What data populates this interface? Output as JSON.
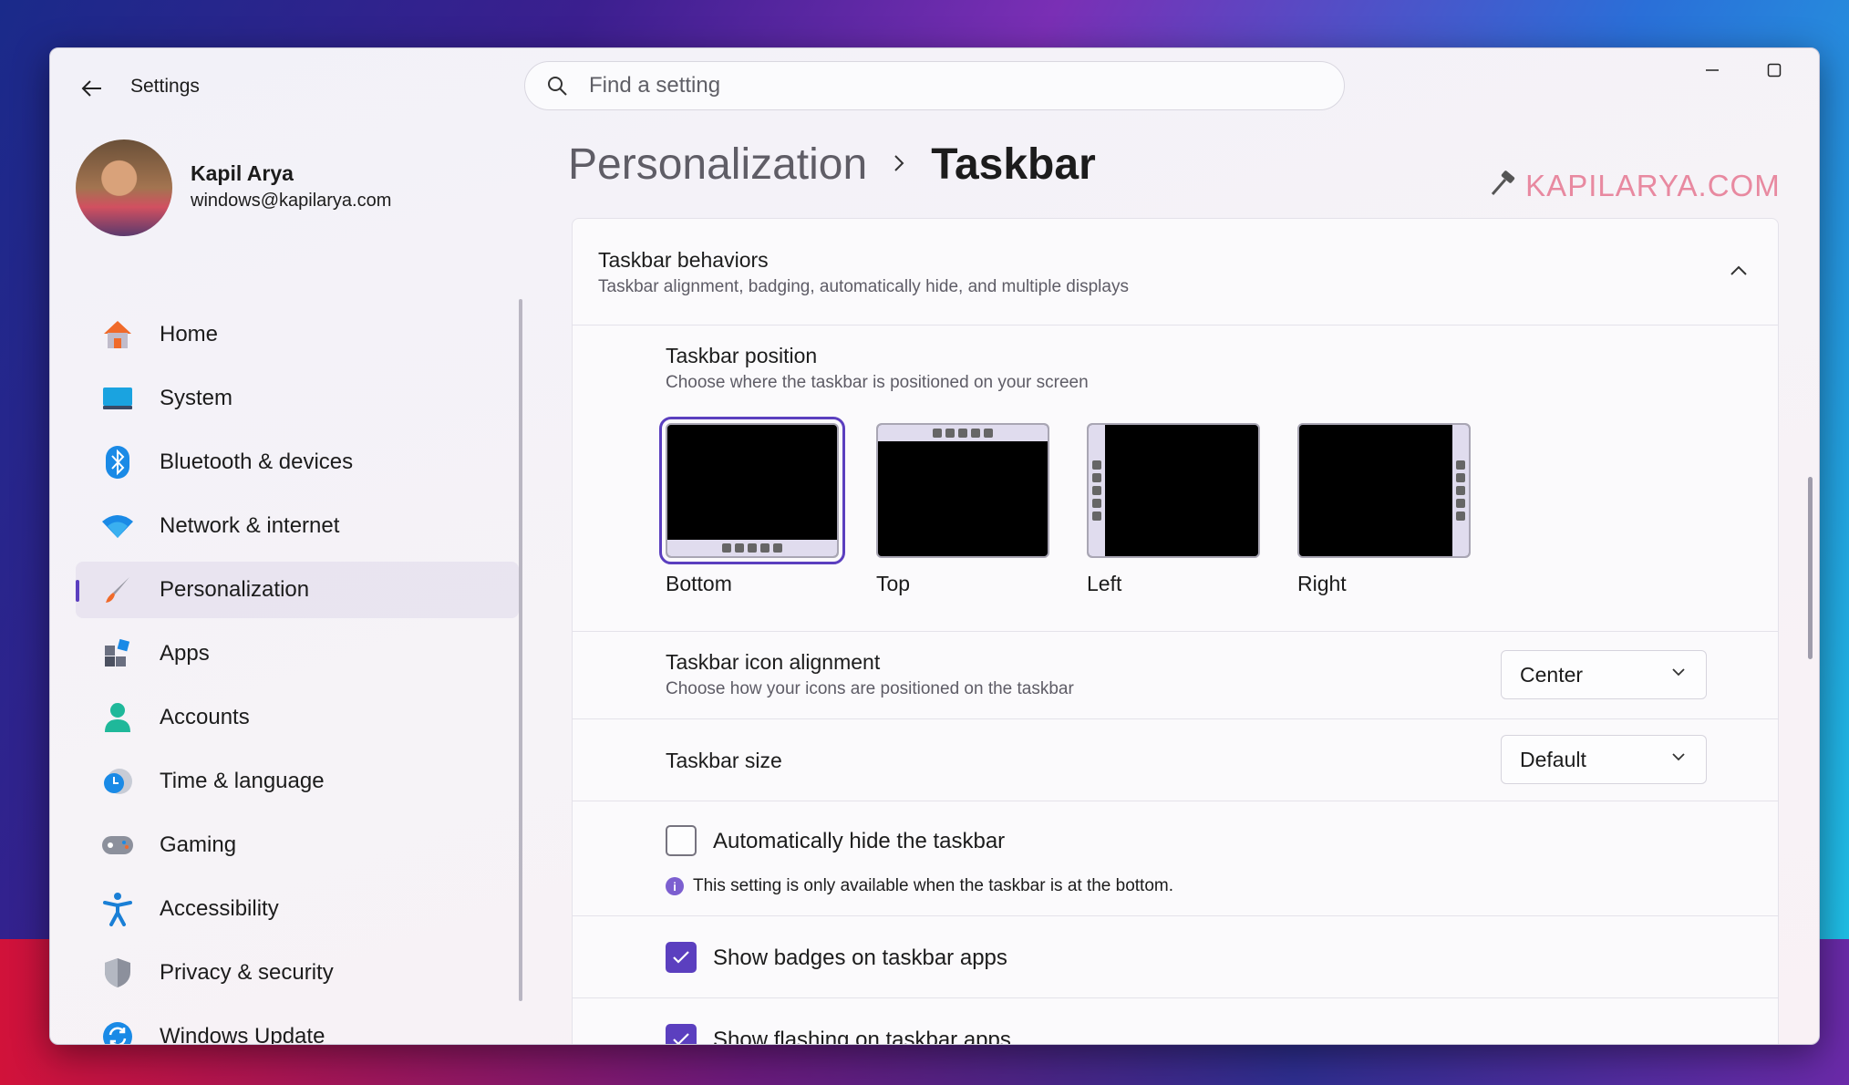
{
  "window": {
    "title": "Settings",
    "controls": {
      "minimize": "—",
      "maximize": "☐",
      "close": "✕"
    }
  },
  "search": {
    "placeholder": "Find a setting",
    "value": ""
  },
  "profile": {
    "name": "Kapil Arya",
    "email": "windows@kapilarya.com"
  },
  "nav": {
    "items": [
      {
        "label": "Home",
        "icon": "home-icon"
      },
      {
        "label": "System",
        "icon": "system-icon"
      },
      {
        "label": "Bluetooth & devices",
        "icon": "bluetooth-icon"
      },
      {
        "label": "Network & internet",
        "icon": "wifi-icon"
      },
      {
        "label": "Personalization",
        "icon": "brush-icon",
        "active": true
      },
      {
        "label": "Apps",
        "icon": "apps-icon"
      },
      {
        "label": "Accounts",
        "icon": "accounts-icon"
      },
      {
        "label": "Time & language",
        "icon": "time-language-icon"
      },
      {
        "label": "Gaming",
        "icon": "gaming-icon"
      },
      {
        "label": "Accessibility",
        "icon": "accessibility-icon"
      },
      {
        "label": "Privacy & security",
        "icon": "shield-icon"
      },
      {
        "label": "Windows Update",
        "icon": "windows-update-icon"
      }
    ]
  },
  "breadcrumb": {
    "parent": "Personalization",
    "current": "Taskbar"
  },
  "watermark": "KAPILARYA.COM",
  "behaviors": {
    "title": "Taskbar behaviors",
    "subtitle": "Taskbar alignment, badging, automatically hide, and multiple displays",
    "position": {
      "title": "Taskbar position",
      "subtitle": "Choose where the taskbar is positioned on your screen",
      "options": [
        "Bottom",
        "Top",
        "Left",
        "Right"
      ],
      "selected": "Bottom"
    },
    "alignment": {
      "title": "Taskbar icon alignment",
      "subtitle": "Choose how your icons are positioned on the taskbar",
      "value": "Center"
    },
    "size": {
      "title": "Taskbar size",
      "value": "Default"
    },
    "autohide": {
      "label": "Automatically hide the taskbar",
      "checked": false,
      "info": "This setting is only available when the taskbar is at the bottom."
    },
    "badges": {
      "label": "Show badges on taskbar apps",
      "checked": true
    },
    "flashing": {
      "label": "Show flashing on taskbar apps",
      "checked": true
    }
  },
  "colors": {
    "accent": "#5b3fbf",
    "info": "#7c5fd0"
  }
}
